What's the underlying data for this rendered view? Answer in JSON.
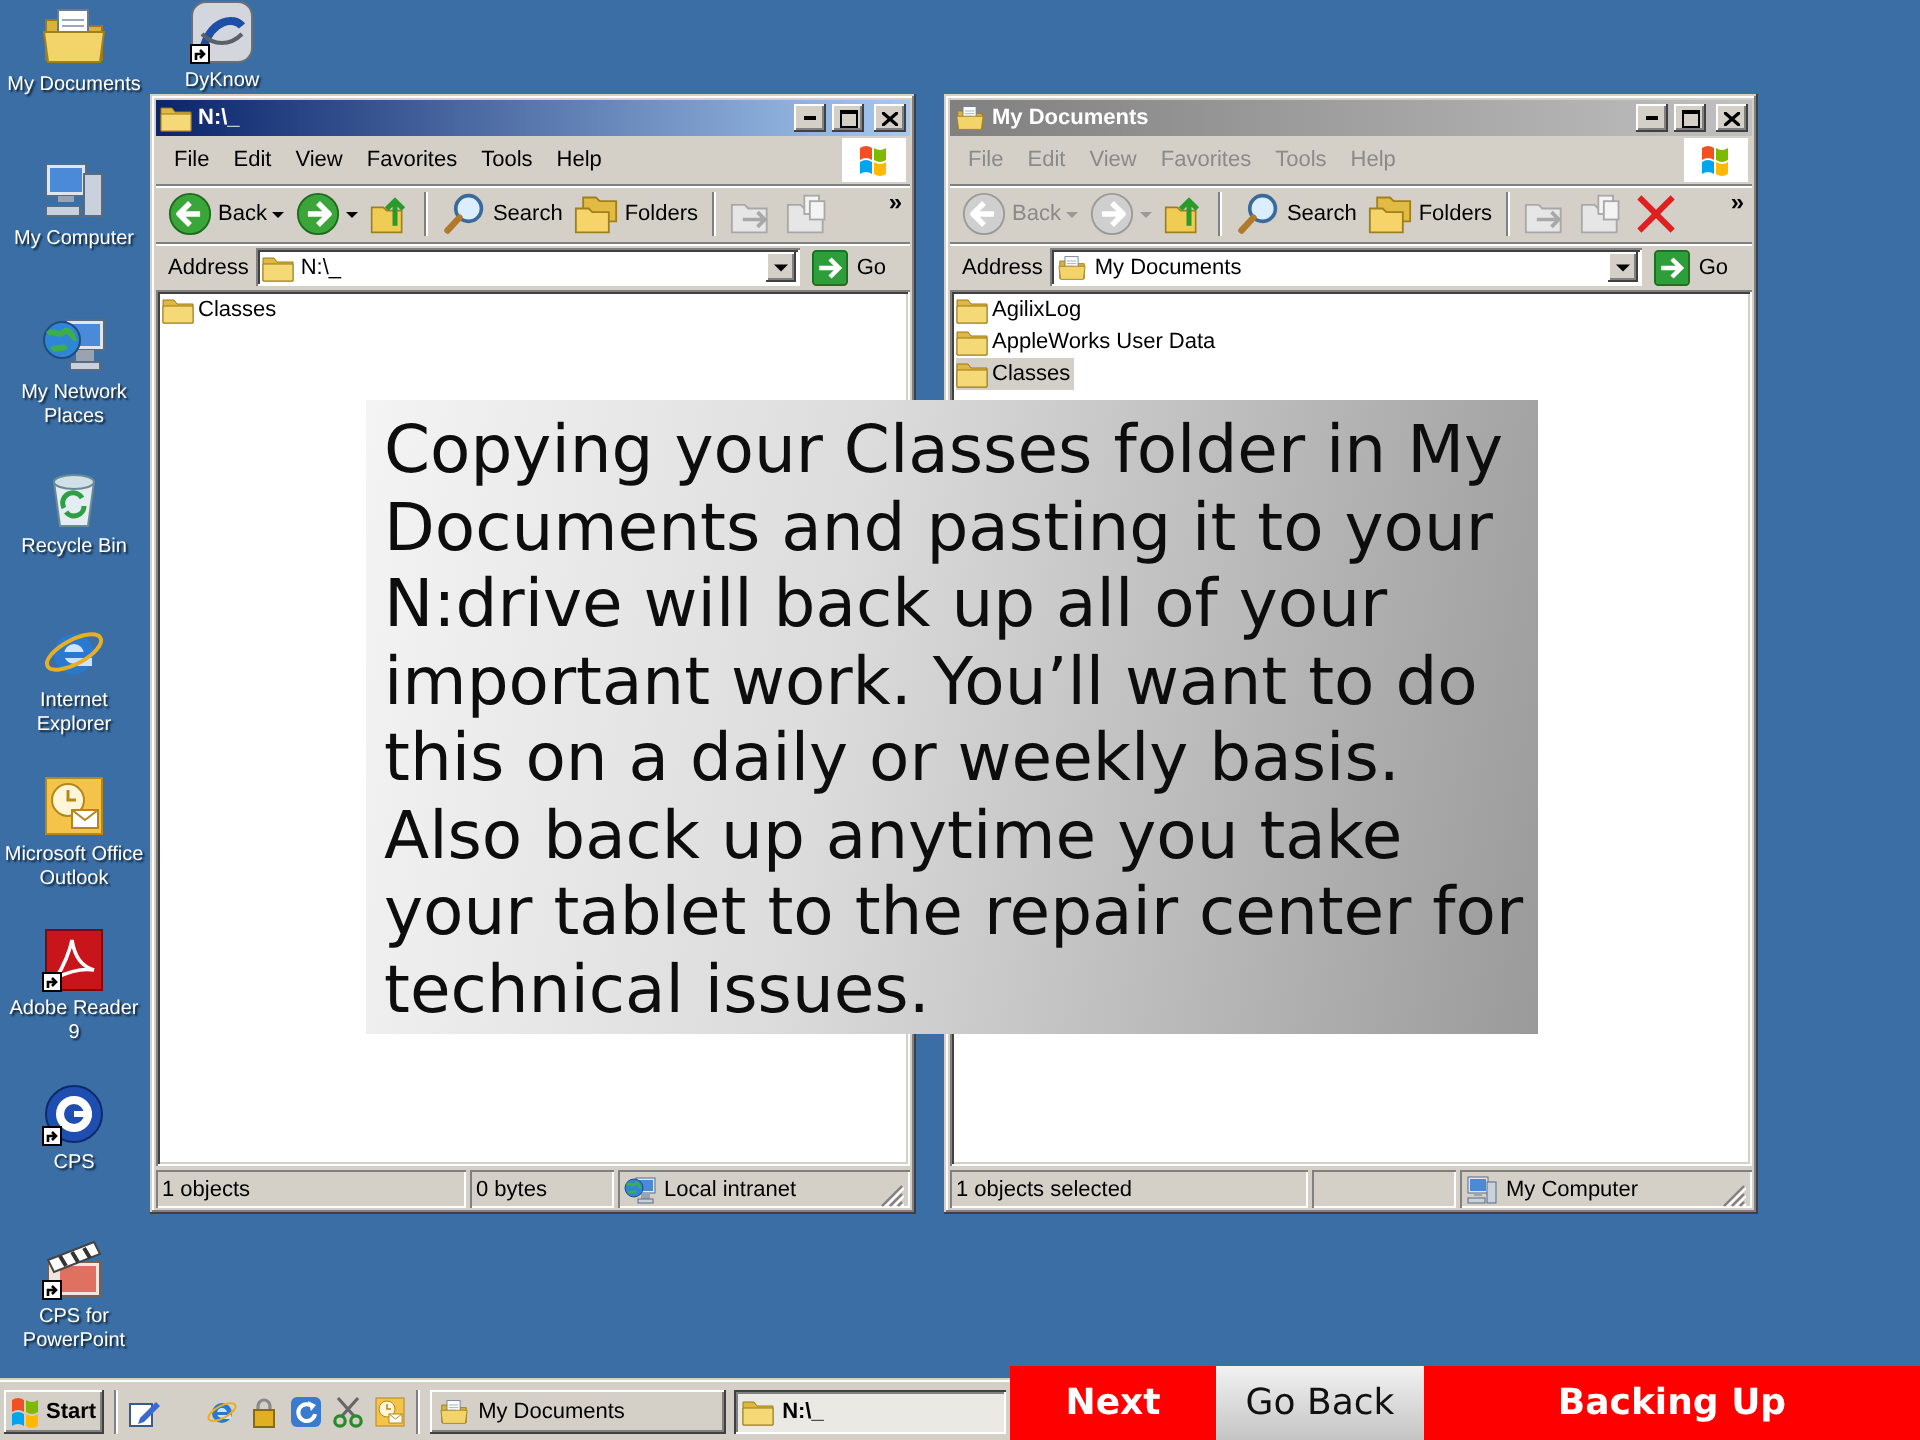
{
  "desktop": {
    "columns": [
      [
        {
          "label": "My Documents",
          "kind": "documents",
          "shortcut": false
        },
        {
          "label": "My Computer",
          "kind": "computer",
          "shortcut": false
        },
        {
          "label": "My Network Places",
          "kind": "network",
          "shortcut": false
        },
        {
          "label": "Recycle Bin",
          "kind": "recycle",
          "shortcut": false
        },
        {
          "label": "Internet Explorer",
          "kind": "browser",
          "shortcut": false
        },
        {
          "label": "Microsoft Office Outlook",
          "kind": "mail",
          "shortcut": false
        },
        {
          "label": "Adobe Reader 9",
          "kind": "reader",
          "shortcut": true
        },
        {
          "label": "CPS",
          "kind": "disc",
          "shortcut": true
        },
        {
          "label": "CPS for PowerPoint",
          "kind": "clapper",
          "shortcut": true
        }
      ],
      [
        {
          "label": "DyKnow",
          "kind": "swoosh",
          "shortcut": true
        }
      ]
    ]
  },
  "windows": [
    {
      "title": "N:\\_",
      "kind": "folder",
      "active": true,
      "menu": [
        "File",
        "Edit",
        "View",
        "Favorites",
        "Tools",
        "Help"
      ],
      "toolbar": [
        {
          "kind": "back",
          "label": "Back",
          "disabled": false
        },
        {
          "kind": "forward",
          "disabled": false
        },
        {
          "kind": "up",
          "disabled": false
        },
        {
          "kind": "search",
          "label": "Search",
          "disabled": false
        },
        {
          "kind": "folders",
          "label": "Folders",
          "disabled": false
        },
        {
          "kind": "move",
          "disabled": true
        },
        {
          "kind": "copy",
          "disabled": true
        }
      ],
      "overflow": "»",
      "address": {
        "label": "Address",
        "value": "N:\\_",
        "go": "Go"
      },
      "items": [
        {
          "name": "Classes",
          "selected": false
        }
      ],
      "status": [
        {
          "kind": "text",
          "text": "1 objects"
        },
        {
          "kind": "text",
          "text": "0 bytes"
        },
        {
          "kind": "intranet",
          "text": "Local intranet"
        }
      ]
    },
    {
      "title": "My Documents",
      "kind": "documents",
      "active": false,
      "menu": [
        "File",
        "Edit",
        "View",
        "Favorites",
        "Tools",
        "Help"
      ],
      "toolbar": [
        {
          "kind": "back",
          "label": "Back",
          "disabled": true
        },
        {
          "kind": "forward",
          "disabled": true
        },
        {
          "kind": "up",
          "disabled": false
        },
        {
          "kind": "search",
          "label": "Search",
          "disabled": false
        },
        {
          "kind": "folders",
          "label": "Folders",
          "disabled": false
        },
        {
          "kind": "move",
          "disabled": true
        },
        {
          "kind": "copy",
          "disabled": true
        },
        {
          "kind": "delete",
          "disabled": false
        }
      ],
      "overflow": "»",
      "address": {
        "label": "Address",
        "value": "My Documents",
        "go": "Go"
      },
      "items": [
        {
          "name": "AgilixLog",
          "selected": false
        },
        {
          "name": "AppleWorks User Data",
          "selected": false
        },
        {
          "name": "Classes",
          "selected": true
        }
      ],
      "status": [
        {
          "kind": "text",
          "text": "1 objects selected"
        },
        {
          "kind": "blank"
        },
        {
          "kind": "computer",
          "text": "My Computer"
        }
      ]
    }
  ],
  "callout": {
    "lines": [
      "Copying your Classes folder in My",
      "Documents and pasting it to your",
      "N:drive will back up all of your",
      "important work. You’ll want to do",
      "this on a daily or weekly basis.",
      "Also back up anytime you take",
      "your tablet to the repair center for",
      "technical issues."
    ]
  },
  "taskbar": {
    "start": "Start",
    "quick_launch": [
      {
        "kind": "pen"
      },
      {
        "kind": "browser"
      },
      {
        "kind": "lock"
      },
      {
        "kind": "refresh"
      },
      {
        "kind": "scissors"
      },
      {
        "kind": "mail"
      }
    ],
    "tasks": [
      {
        "label": "My Documents",
        "kind": "documents",
        "selected": false
      },
      {
        "label": "N:\\_",
        "kind": "folder",
        "selected": true
      }
    ]
  },
  "nav": [
    {
      "label": "Next",
      "kind": "primary"
    },
    {
      "label": "Go Back",
      "kind": "secondary"
    },
    {
      "label": "Backing Up",
      "kind": "banner"
    }
  ]
}
